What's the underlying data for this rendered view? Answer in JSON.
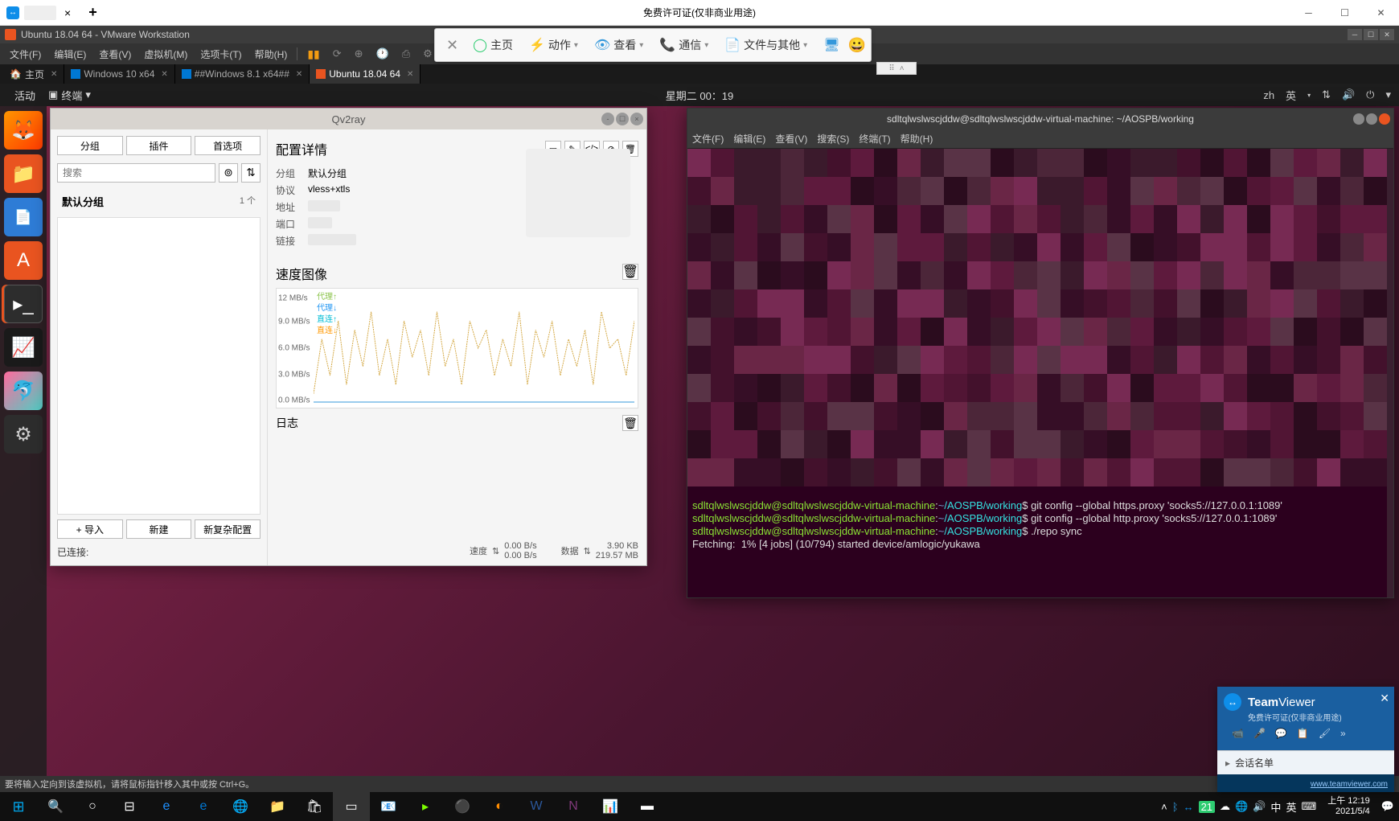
{
  "teamviewer_top": {
    "license_text": "免费许可证(仅非商业用途)",
    "close_x": "×",
    "plus": "+"
  },
  "vmware": {
    "title": "Ubuntu 18.04 64 - VMware Workstation",
    "menu": [
      "文件(F)",
      "编辑(E)",
      "查看(V)",
      "虚拟机(M)",
      "选项卡(T)",
      "帮助(H)"
    ],
    "tabs": {
      "home": "主页",
      "win10": "Windows 10 x64",
      "win81": "##Windows 8.1 x64##",
      "ubuntu": "Ubuntu 18.04 64"
    },
    "status": "要将输入定向到该虚拟机，请将鼠标指针移入其中或按 Ctrl+G。"
  },
  "float_toolbar": {
    "home": "主页",
    "actions": "动作",
    "view": "查看",
    "comm": "通信",
    "files": "文件与其他"
  },
  "ubuntu_top": {
    "activities": "活动",
    "terminal_label": "终端",
    "datetime": "星期二 00：19",
    "lang1": "zh",
    "lang2": "英"
  },
  "qv2ray": {
    "title": "Qv2ray",
    "btn_group": "分组",
    "btn_plugin": "插件",
    "btn_pref": "首选项",
    "search_placeholder": "搜索",
    "default_group": "默认分组",
    "group_count": "1 个",
    "btn_import": "+ 导入",
    "btn_new": "新建",
    "btn_complex": "新复杂配置",
    "connected": "已连接:",
    "sec_detail": "配置详情",
    "detail": {
      "group_lbl": "分组",
      "group_val": "默认分组",
      "proto_lbl": "协议",
      "proto_val": "vless+xtls",
      "addr_lbl": "地址",
      "port_lbl": "端口",
      "link_lbl": "链接"
    },
    "sec_speed": "速度图像",
    "legend": {
      "pu": "代理↑",
      "pd": "代理↓",
      "du": "直连↑",
      "dd": "直连↓"
    },
    "sec_log": "日志",
    "speed_lbl": "速度",
    "speed_up": "0.00 B/s",
    "speed_dn": "0.00 B/s",
    "data_lbl": "数据",
    "data_up": "3.90 KB",
    "data_dn": "219.57 MB"
  },
  "chart_data": {
    "type": "line",
    "ylabel": "MB/s",
    "ylim": [
      0,
      12
    ],
    "yticks": [
      "0.0 MB/s",
      "3.0 MB/s",
      "6.0 MB/s",
      "9.0 MB/s",
      "12 MB/s"
    ],
    "series": [
      {
        "name": "代理↑",
        "color": "#8bc34a",
        "values": [
          0,
          0,
          0,
          0,
          0
        ]
      },
      {
        "name": "代理↓",
        "color": "#2196f3",
        "values": [
          0,
          0,
          0,
          0,
          0
        ]
      },
      {
        "name": "直连↑",
        "color": "#00bcd4",
        "values": [
          0,
          0,
          0,
          0,
          0
        ]
      },
      {
        "name": "直连↓",
        "color": "#ff9800",
        "values": [
          1,
          7,
          3,
          9,
          2,
          8,
          4,
          10,
          3,
          7,
          2,
          9,
          5,
          8,
          3,
          10,
          4,
          7,
          2,
          9,
          6,
          8,
          3,
          7,
          4,
          10,
          2,
          8,
          5,
          9,
          3,
          7,
          4,
          8,
          2,
          10,
          6,
          7,
          3,
          9
        ]
      }
    ]
  },
  "terminal": {
    "title": "sdltqlwslwscjddw@sdltqlwslwscjddw-virtual-machine: ~/AOSPB/working",
    "menu": [
      "文件(F)",
      "编辑(E)",
      "查看(V)",
      "搜索(S)",
      "终端(T)",
      "帮助(H)"
    ],
    "user": "sdltqlwslwscjddw@sdltqlwslwscjddw-virtual-machine",
    "path": "~/AOSPB/working",
    "cmd1": "git config --global https.proxy 'socks5://127.0.0.1:1089'",
    "cmd2": "git config --global http.proxy 'socks5://127.0.0.1:1089'",
    "cmd3": "./repo sync",
    "fetch": "Fetching:  1% [4 jobs] (10/794) started device/amlogic/yukawa"
  },
  "tv_panel": {
    "brand1": "Team",
    "brand2": "Viewer",
    "sub": "免费许可证(仅非商业用途)",
    "sessions": "会话名单",
    "link": "www.teamviewer.com"
  },
  "win_taskbar": {
    "time": "上午 12:19",
    "date": "2021/5/4",
    "temp": "21",
    "ime1": "中",
    "ime2": "英"
  }
}
